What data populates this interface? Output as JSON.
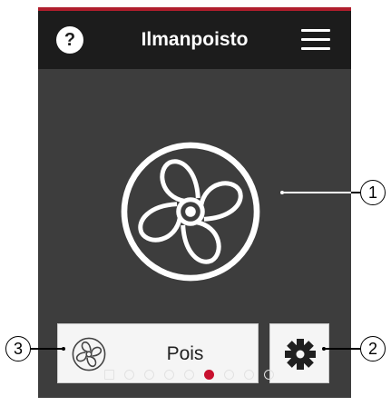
{
  "header": {
    "title": "Ilmanpoisto",
    "help_icon": "?",
    "menu_icon": "hamburger-menu-icon"
  },
  "main": {
    "fan_icon": "fan-icon"
  },
  "controls": {
    "mode_label": "Pois",
    "mode_icon": "fan-icon",
    "settings_icon": "gear-icon"
  },
  "pager": {
    "count": 8,
    "active_index": 5
  },
  "callouts": {
    "one": "1",
    "two": "2",
    "three": "3"
  },
  "colors": {
    "screen_bg": "#3d3d3d",
    "header_bg": "#1c1c1c",
    "accent": "#b01e2d",
    "active_dot": "#c8102e"
  }
}
